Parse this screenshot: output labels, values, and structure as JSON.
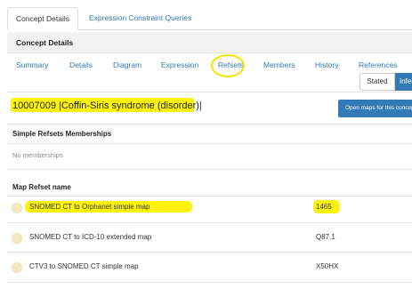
{
  "top_tabs": {
    "concept_details": "Concept Details",
    "expression_constraint_queries": "Expression Constraint Queries"
  },
  "panel": {
    "title": "Concept Details"
  },
  "subnav": {
    "summary": "Summary",
    "details": "Details",
    "diagram": "Diagram",
    "expression": "Expression",
    "refsets": "Refsets",
    "members": "Members",
    "history": "History",
    "references": "References"
  },
  "view_toggle": {
    "stated": "Stated",
    "inferred": "Inferred"
  },
  "concept": {
    "title": "10007009 |Coffin-Siris syndrome (disorder)|"
  },
  "open_maps_button": "Open maps for this concept",
  "simple_refsets": {
    "heading": "Simple Refsets Memberships",
    "empty_text": "No memberships"
  },
  "map_refsets": {
    "heading": "Map Refset name",
    "rows": [
      {
        "name": "SNOMED CT to Orphanet simple map",
        "code": "1465"
      },
      {
        "name": "SNOMED CT to ICD-10 extended map",
        "code": "Q87.1"
      },
      {
        "name": "CTV3 to SNOMED CT simple map",
        "code": "X50HX"
      }
    ]
  },
  "colors": {
    "link": "#337ab7",
    "primary_button": "#337ab7",
    "highlight": "#fff200",
    "dot": "#f5e9c3"
  }
}
